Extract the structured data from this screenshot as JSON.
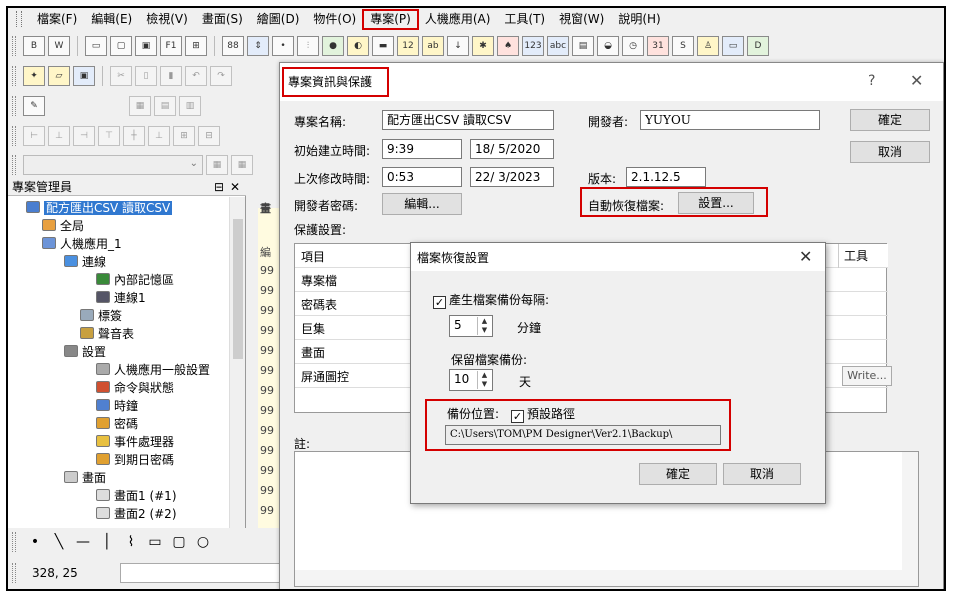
{
  "menubar": {
    "items": [
      "檔案(F)",
      "編輯(E)",
      "檢視(V)",
      "畫面(S)",
      "繪圖(D)",
      "物件(O)",
      "專案(P)",
      "人機應用(A)",
      "工具(T)",
      "視窗(W)",
      "說明(H)"
    ],
    "active_index": 6
  },
  "left_panel": {
    "title": "專案管理員",
    "pin_icon": "⊟",
    "close_icon": "✕",
    "tree": [
      {
        "label": "配方匯出CSV 讀取CSV",
        "icon": "project-icon",
        "selected": true
      },
      {
        "label": "全局",
        "icon": "globe-icon"
      },
      {
        "label": "人機應用_1",
        "icon": "hmi-icon"
      },
      {
        "label": "連線",
        "icon": "link-icon"
      },
      {
        "label": "內部記憶區",
        "icon": "memory-icon"
      },
      {
        "label": "連線1",
        "icon": "connection-icon"
      },
      {
        "label": "標簽",
        "icon": "tag-icon"
      },
      {
        "label": "聲音表",
        "icon": "sound-icon"
      },
      {
        "label": "設置",
        "icon": "settings-icon"
      },
      {
        "label": "人機應用一般設置",
        "icon": "general-settings-icon"
      },
      {
        "label": "命令與狀態",
        "icon": "command-icon"
      },
      {
        "label": "時鐘",
        "icon": "clock-icon"
      },
      {
        "label": "密碼",
        "icon": "password-icon"
      },
      {
        "label": "事件處理器",
        "icon": "event-icon"
      },
      {
        "label": "到期日密碼",
        "icon": "expiry-icon"
      },
      {
        "label": "畫面",
        "icon": "screens-icon"
      },
      {
        "label": "畫面1 (#1)",
        "icon": "screen-icon"
      },
      {
        "label": "畫面2 (#2)",
        "icon": "screen-icon"
      }
    ]
  },
  "status": {
    "coords": "328, 25"
  },
  "editor_strip": {
    "header": "編",
    "tab": "畫",
    "cells": [
      "99",
      "99",
      "99",
      "99",
      "99",
      "99",
      "99",
      "99",
      "99",
      "99",
      "99",
      "99",
      "99"
    ]
  },
  "project_dialog": {
    "title": "專案資訊與保護",
    "help_icon": "?",
    "close_icon": "✕",
    "name_label": "專案名稱:",
    "name_value": "配方匯出CSV 讀取CSV",
    "developer_label": "開發者:",
    "developer_value": "YUYOU",
    "created_label": "初始建立時間:",
    "created_time": "9:39",
    "created_date": "18/ 5/2020",
    "modified_label": "上次修改時間:",
    "modified_time": "0:53",
    "modified_date": "22/ 3/2023",
    "version_label": "版本:",
    "version_value": "2.1.12.5",
    "password_label": "開發者密碼:",
    "edit_button": "編輯...",
    "autorecover_label": "自動恢復檔案:",
    "setup_button": "設置...",
    "ok_button": "確定",
    "cancel_button": "取消",
    "protection_label": "保護設置:",
    "table_header": {
      "item": "項目",
      "tool": "工具"
    },
    "table_rows": [
      "專案檔",
      "密碼表",
      "巨集",
      "畫面",
      "屏通圖控"
    ],
    "write_button": "Write...",
    "notes_label": "註:"
  },
  "recovery_dialog": {
    "title": "檔案恢復設置",
    "close_icon": "✕",
    "backup_interval_label": "產生檔案備份每隔:",
    "backup_interval_checked": true,
    "interval_value": "5",
    "interval_unit": "分鐘",
    "keep_label": "保留檔案備份:",
    "keep_value": "10",
    "keep_unit": "天",
    "location_label": "備份位置:",
    "default_path_label": "預設路徑",
    "default_path_checked": true,
    "path_value": "C:\\Users\\TOM\\PM Designer\\Ver2.1\\Backup\\",
    "ok_button": "確定",
    "cancel_button": "取消"
  },
  "colors": {
    "highlight_red": "#d40000",
    "selection_blue": "#3078d0"
  }
}
